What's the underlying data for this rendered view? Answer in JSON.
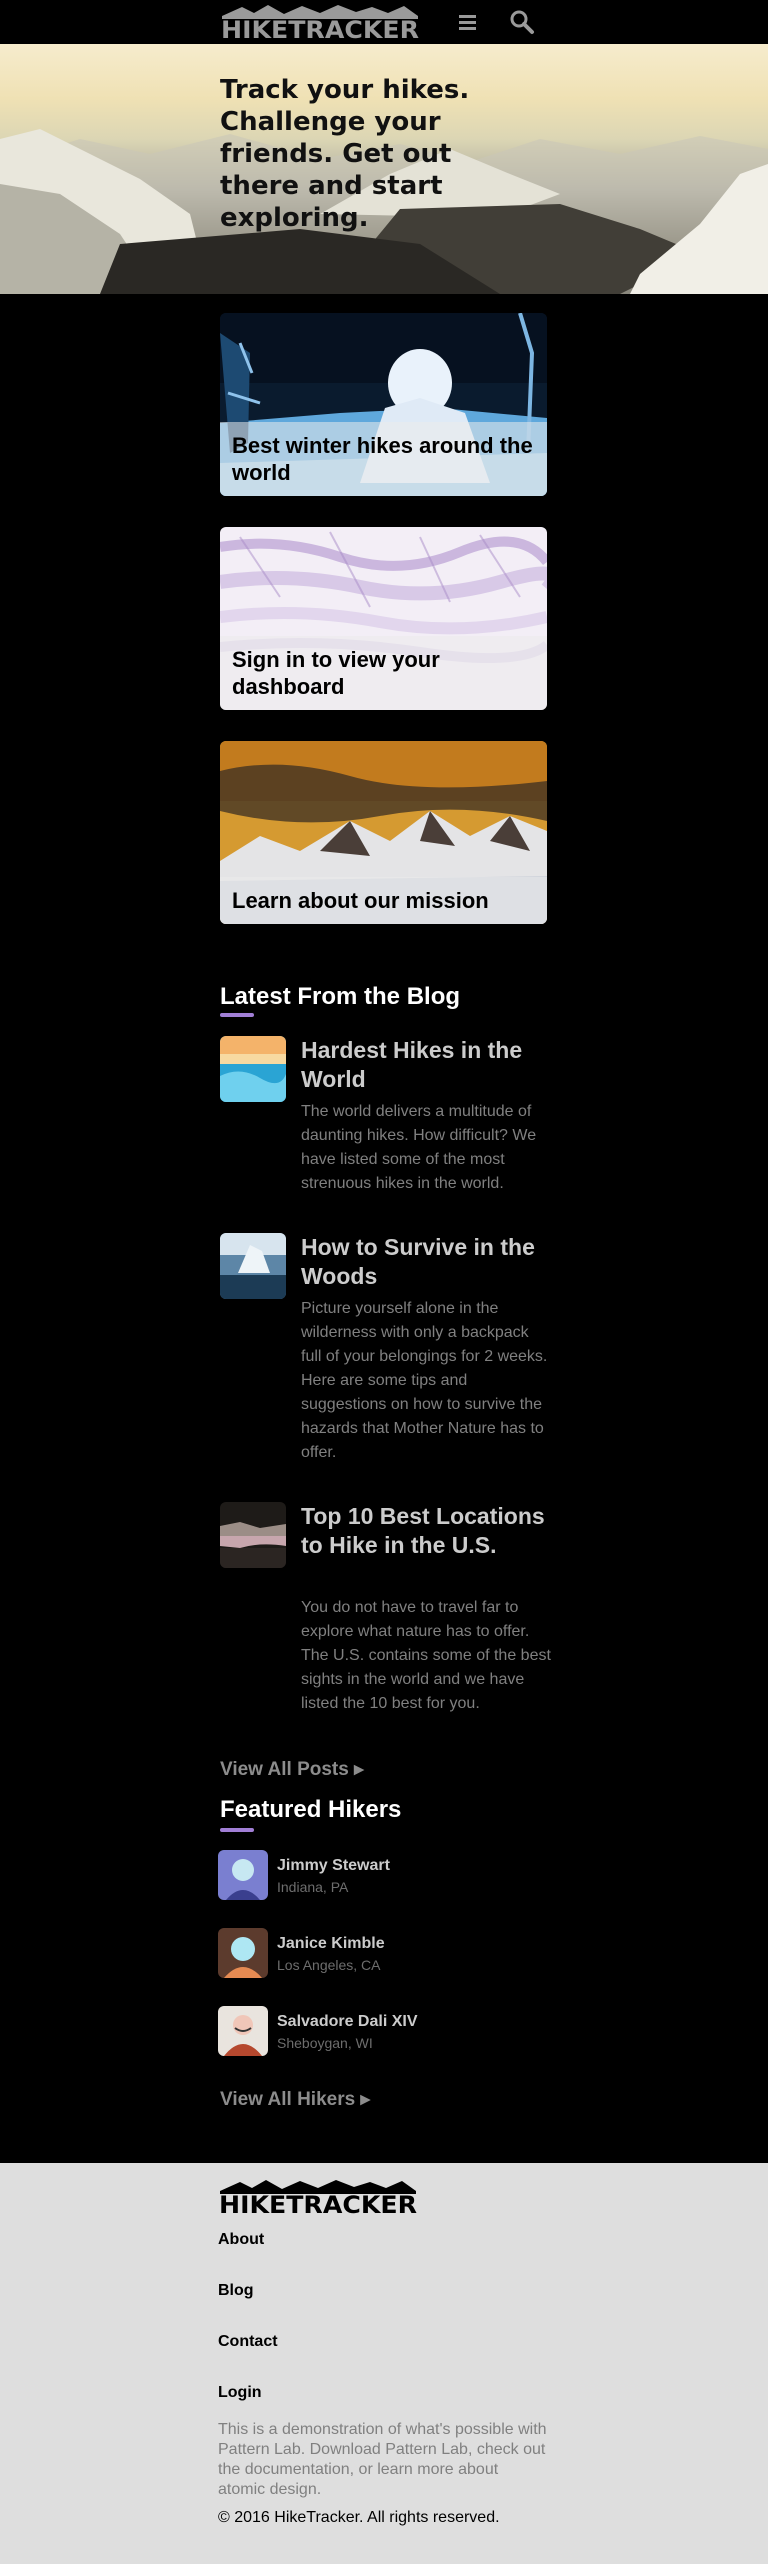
{
  "header": {
    "logo_text": "HIKETRACKER",
    "menu_icon": "hamburger-menu-icon",
    "search_icon": "magnifier-search-icon"
  },
  "hero": {
    "title": "Track your hikes. Challenge your friends. Get out there and start exploring."
  },
  "cards": [
    {
      "label": "Best winter hikes around the world"
    },
    {
      "label": "Sign in to view your dashboard"
    },
    {
      "label": "Learn about our mission"
    }
  ],
  "blog": {
    "title": "Latest From the Blog",
    "posts": [
      {
        "title": "Hardest Hikes in the World",
        "excerpt": "The world delivers a multitude of daunting hikes. How difficult? We have listed some of the most strenuous hikes in the world."
      },
      {
        "title": "How to Survive in the Woods",
        "excerpt": "Picture yourself alone in the wilderness with only a backpack full of your belongings for 2 weeks. Here are some tips and suggestions on how to survive the hazards that Mother Nature has to offer."
      },
      {
        "title": "Top 10 Best Locations to Hike in the U.S.",
        "excerpt": "You do not have to travel far to explore what nature has to offer. The U.S. contains some of the best sights in the world and we have listed the 10 best for you."
      }
    ],
    "view_all": "View All Posts ▸"
  },
  "hikers": {
    "title": "Featured Hikers",
    "items": [
      {
        "name": "Jimmy Stewart",
        "location": "Indiana, PA"
      },
      {
        "name": "Janice Kimble",
        "location": "Los Angeles, CA"
      },
      {
        "name": "Salvadore Dali XIV",
        "location": "Sheboygan, WI"
      }
    ],
    "view_all": "View All Hikers ▸"
  },
  "footer": {
    "logo_text": "HIKETRACKER",
    "links": [
      "About",
      "Blog",
      "Contact",
      "Login"
    ],
    "note": "This is a demonstration of what's possible with Pattern Lab. Download Pattern Lab, check out the documentation, or learn more about atomic design.",
    "copyright": "© 2016 HikeTracker. All rights reserved."
  },
  "colors": {
    "accent": "#a17fd6",
    "page_background": "#000000",
    "footer_background": "#dedede",
    "muted_text": "#808080"
  }
}
